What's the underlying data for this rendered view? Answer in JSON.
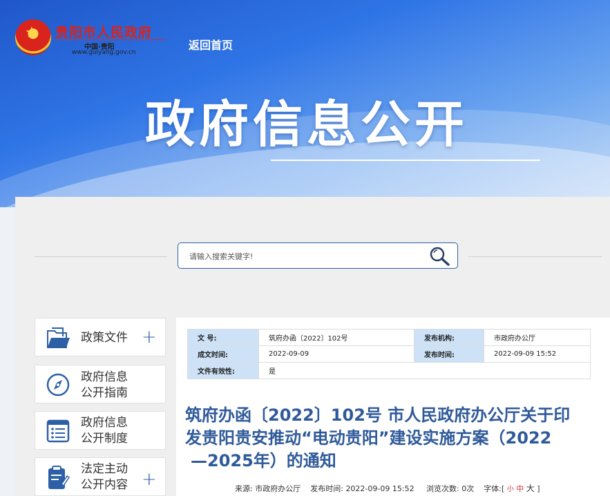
{
  "header": {
    "logo_title": "贵阳市人民政府",
    "logo_subtitle": "中国·贵阳",
    "logo_url": "www.guiyang.gov.cn",
    "home_link": "返回首页",
    "banner_title": "政府信息公开"
  },
  "search": {
    "placeholder": "请输入搜索关键字!"
  },
  "sidebar": {
    "items": [
      {
        "label_line1": "政策文件",
        "label_line2": "",
        "icon": "folder-icon",
        "has_plus": true
      },
      {
        "label_line1": "政府信息",
        "label_line2": "公开指南",
        "icon": "compass-icon",
        "has_plus": false
      },
      {
        "label_line1": "政府信息",
        "label_line2": "公开制度",
        "icon": "list-document-icon",
        "has_plus": false
      },
      {
        "label_line1": "法定主动",
        "label_line2": "公开内容",
        "icon": "clipboard-edit-icon",
        "has_plus": true
      }
    ],
    "plus_symbol": "+"
  },
  "meta": {
    "doc_no_label": "文 号:",
    "doc_no": "筑府办函〔2022〕102号",
    "issuer_label": "发布机构:",
    "issuer": "市政府办公厅",
    "created_label": "成文时间:",
    "created": "2022-09-09",
    "published_label": "发布时间:",
    "published": "2022-09-09 15:52",
    "validity_label": "文件有效性:",
    "validity": "是"
  },
  "document": {
    "title_line1": "筑府办函〔2022〕102号 市人民政府办公厅关于印",
    "title_line2": "发贵阳贵安推动“电动贵阳”建设实施方案（2022",
    "title_line3": "—2025年）的通知",
    "source_label": "来源:",
    "source": "市政府办公厅",
    "time_label": "发布时间:",
    "time": "2022-09-09 15:52",
    "views_label": "浏览次数:",
    "views": "0次",
    "font_label": "字体:[",
    "font_small": "小",
    "font_medium": "中",
    "font_large": "大",
    "font_close": "]"
  },
  "colors": {
    "accent": "#2d5fa7",
    "title_blue": "#2f5a9a",
    "header_cell": "#cde2f7",
    "emblem_red": "#d8241c"
  }
}
